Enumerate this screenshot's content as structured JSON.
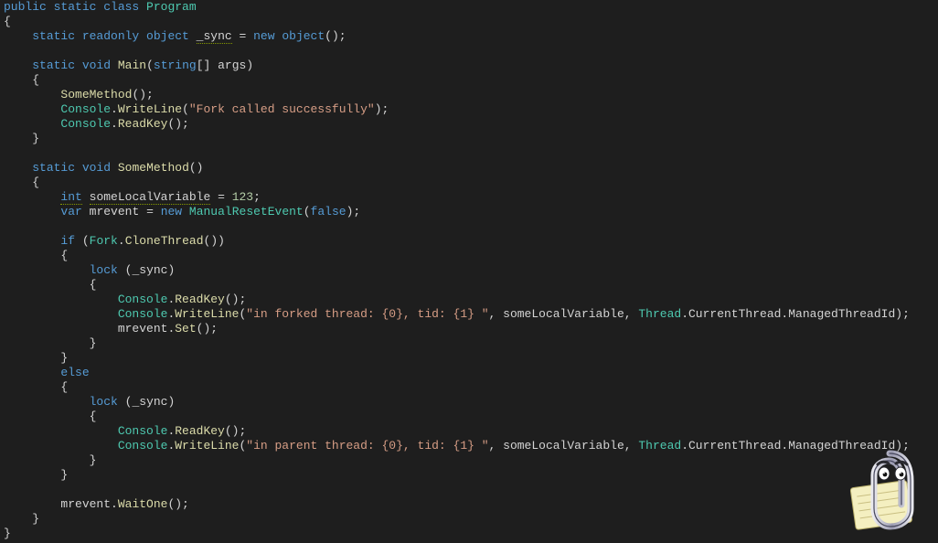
{
  "code": {
    "class_modifiers": "public static class",
    "class_name": "Program",
    "field_modifiers": "static readonly object",
    "field_name": "_sync",
    "field_init_new": "new",
    "field_init_type": "object",
    "main_modifiers": "static void",
    "main_name": "Main",
    "main_param_type": "string",
    "main_param_name": "args",
    "call_SomeMethod": "SomeMethod",
    "type_Console": "Console",
    "call_WriteLine": "WriteLine",
    "str_fork_called": "\"Fork called successfully\"",
    "call_ReadKey": "ReadKey",
    "sm_modifiers": "static void",
    "sm_name": "SomeMethod",
    "kw_int": "int",
    "var_someLocal": "someLocalVariable",
    "num_123": "123",
    "kw_var": "var",
    "var_mrevent": "mrevent",
    "kw_new": "new",
    "type_MRE": "ManualResetEvent",
    "kw_false": "false",
    "kw_if": "if",
    "type_Fork": "Fork",
    "call_CloneThread": "CloneThread",
    "kw_lock": "lock",
    "str_forked": "\"in forked thread: {0}, tid: {1} \"",
    "type_Thread": "Thread",
    "prop_CurrentThread": "CurrentThread",
    "prop_ManagedThreadId": "ManagedThreadId",
    "call_Set": "Set",
    "kw_else": "else",
    "str_parent": "\"in parent thread: {0}, tid: {1} \"",
    "call_WaitOne": "WaitOne"
  },
  "assistant": {
    "name": "clippy"
  }
}
